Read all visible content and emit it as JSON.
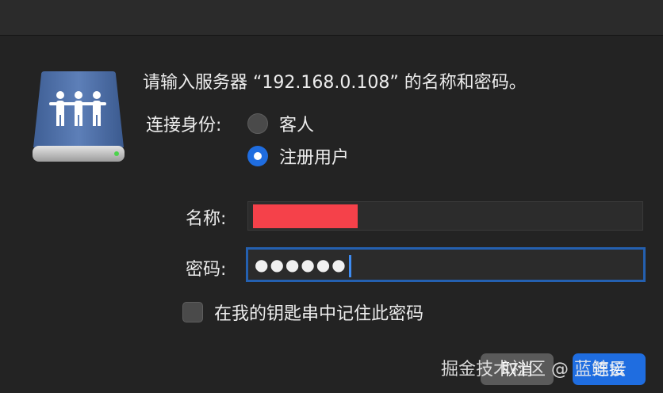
{
  "dialog": {
    "prompt": "请输入服务器 “192.168.0.108” 的名称和密码。",
    "connect_as_label": "连接身份:",
    "options": [
      {
        "label": "客人",
        "selected": false
      },
      {
        "label": "注册用户",
        "selected": true
      }
    ],
    "name_label": "名称:",
    "name_value": "",
    "password_label": "密码:",
    "password_masked": "●●●●●●",
    "remember_label": "在我的钥匙串中记住此密码",
    "remember_checked": false,
    "cancel_button": "取消",
    "connect_button": "连接"
  },
  "icon": "server-drive-icon",
  "colors": {
    "accent": "#1f6de0",
    "redaction": "#f5414a",
    "background": "#232323"
  },
  "watermark": "掘金技术社区 @ 蓝鲸云"
}
